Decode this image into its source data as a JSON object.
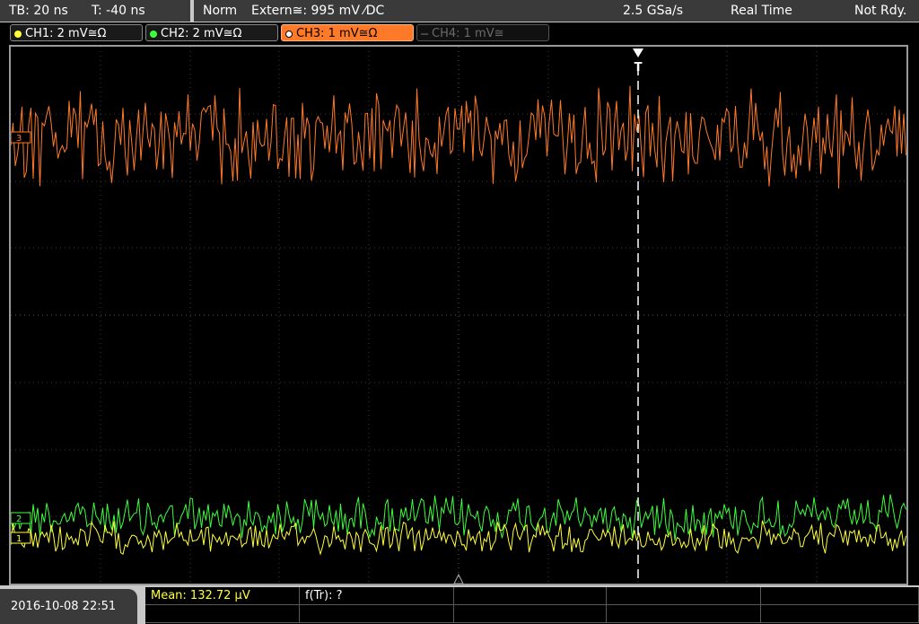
{
  "header": {
    "timebase": "TB: 20 ns",
    "trigger_time": "T: -40 ns",
    "trigger_mode": "Norm",
    "trigger_source": "Extern≅: 995 mV ⁄DC",
    "sample_rate": "2.5 GSa/s",
    "acq_mode": "Real Time",
    "status": "Not Rdy."
  },
  "channels": [
    {
      "label": "CH1: 2 mV≅Ω",
      "color": "#ffff3c",
      "state": "on"
    },
    {
      "label": "CH2: 2 mV≅Ω",
      "color": "#3cff3c",
      "state": "on"
    },
    {
      "label": "CH3: 1 mV≅Ω",
      "color": "#ff7a28",
      "state": "selected"
    },
    {
      "label": "CH4: 1 mV≅",
      "color": "#6a6a6a",
      "state": "off"
    }
  ],
  "display": {
    "trigger_marker": "T",
    "ch_marker_3": "3",
    "ch_marker_2": "2",
    "ch_marker_1": "1"
  },
  "footer": {
    "datetime": "2016-10-08 22:51",
    "mean": "Mean: 132.72 µV",
    "ftr": "f(Tr): ?"
  }
}
